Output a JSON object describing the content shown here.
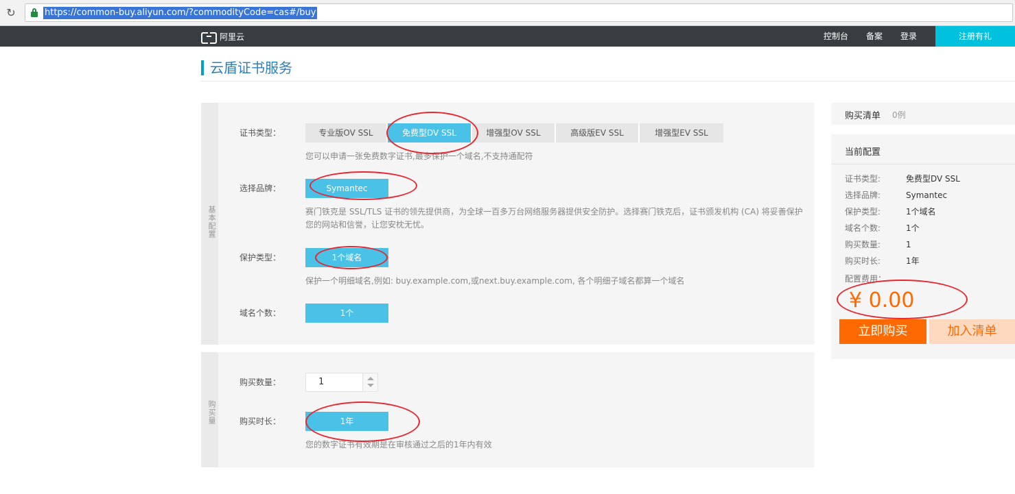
{
  "browser": {
    "url": "https://common-buy.aliyun.com/?commodityCode=cas#/buy",
    "reload_icon": "reload-icon",
    "lock_icon": "lock-icon"
  },
  "topnav": {
    "logo_text": "阿里云",
    "links": [
      "控制台",
      "备案",
      "登录"
    ],
    "register": "注册有礼"
  },
  "page_title": "云盾证书服务",
  "basic": {
    "section_label": "基本配置",
    "cert_type_label": "证书类型：",
    "cert_types": [
      "专业版OV SSL",
      "免费型DV SSL",
      "增强型OV SSL",
      "高级版EV SSL",
      "增强型EV SSL"
    ],
    "cert_type_selected": "免费型DV SSL",
    "cert_type_hint": "您可以申请一张免费数字证书,最多保护一个域名,不支持通配符",
    "brand_label": "选择品牌：",
    "brand": "Symantec",
    "brand_hint": "赛门铁克是 SSL/TLS 证书的领先提供商，为全球一百多万台网络服务器提供安全防护。选择赛门铁克后，证书颁发机构 (CA) 将妥善保护您的网站和信誉，让您安枕无忧。",
    "protect_label": "保护类型：",
    "protect": "1个域名",
    "protect_hint": "保护一个明细域名,例如: buy.example.com,或next.buy.example.com, 各个明细子域名都算一个域名",
    "domain_count_label": "域名个数：",
    "domain_count": "1个"
  },
  "purchase": {
    "section_label": "购买量",
    "qty_label": "购买数量：",
    "qty": "1",
    "duration_label": "购买时长：",
    "duration": "1年",
    "duration_hint": "您的数字证书有效期是在审核通过之后的1年内有效"
  },
  "cart": {
    "title": "购买清单",
    "count": "0例"
  },
  "config": {
    "title": "当前配置",
    "rows": [
      {
        "k": "证书类型:",
        "v": "免费型DV SSL"
      },
      {
        "k": "选择品牌:",
        "v": "Symantec"
      },
      {
        "k": "保护类型:",
        "v": "1个域名"
      },
      {
        "k": "域名个数:",
        "v": "1个"
      },
      {
        "k": "购买数量:",
        "v": "1"
      },
      {
        "k": "购买时长:",
        "v": "1年"
      }
    ],
    "fee_label": "配置费用：",
    "price": "¥ 0.00",
    "buy_now": "立即购买",
    "add_cart": "加入清单"
  },
  "colors": {
    "accent": "#4ac2e8",
    "nav_bg": "#373d41",
    "register_bg": "#00c1de",
    "price": "#ff6a00",
    "annotation": "#e8262d"
  }
}
